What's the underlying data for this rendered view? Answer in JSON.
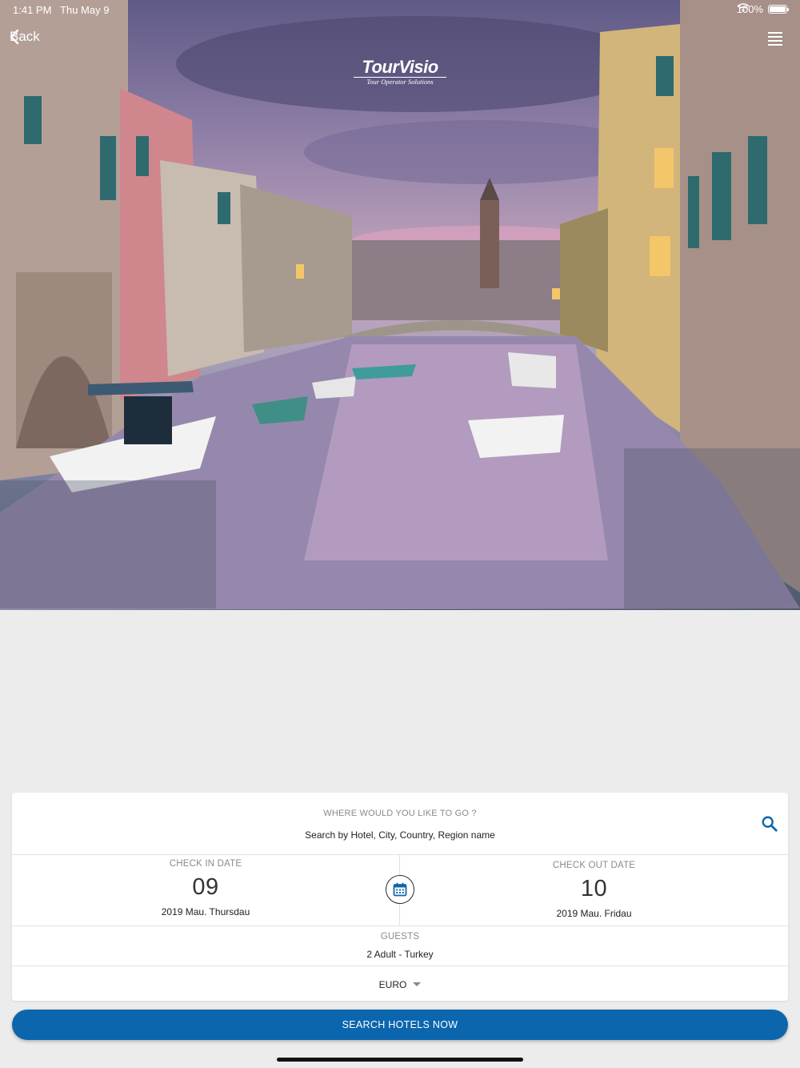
{
  "status_bar": {
    "time": "1:41 PM",
    "date": "Thu May 9",
    "battery": "100%",
    "wifi_icon": "wifi-icon",
    "battery_icon": "battery-icon"
  },
  "nav": {
    "back_label": "Back",
    "back_icon": "chevron-left-icon",
    "menu_icon": "hamburger-menu-icon"
  },
  "logo": {
    "brand": "TourVisio",
    "tagline": "Tour Operator Solutions"
  },
  "hero": {
    "image": "venice-canal-photo"
  },
  "search": {
    "destination_label": "WHERE WOULD YOU LIKE TO GO ?",
    "destination_placeholder": "Search by Hotel, City, Country, Region name",
    "search_icon": "search-icon",
    "check_in": {
      "label": "CHECK IN DATE",
      "day": "09",
      "detail": "2019 Mau. Thursdau"
    },
    "check_out": {
      "label": "CHECK OUT DATE",
      "day": "10",
      "detail": "2019 Mau. Fridau"
    },
    "calendar_icon": "calendar-icon",
    "guests": {
      "label": "GUESTS",
      "value": "2 Adult - Turkey"
    },
    "currency": {
      "value": "EURO",
      "icon": "caret-down-icon"
    },
    "submit_label": "SEARCH HOTELS NOW"
  },
  "colors": {
    "primary": "#0c66ad",
    "background": "#ececec",
    "card": "#ffffff",
    "label_gray": "#8a8a8a"
  }
}
